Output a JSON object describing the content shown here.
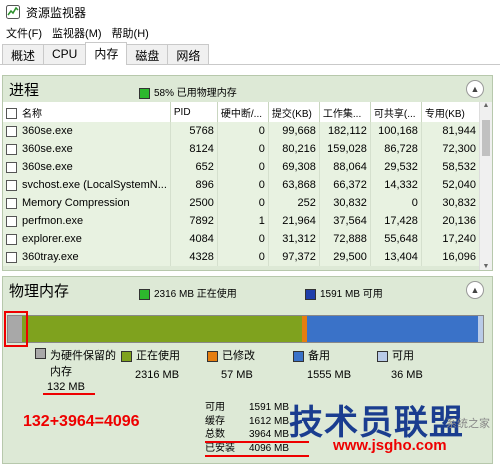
{
  "window": {
    "title": "资源监视器"
  },
  "menu": [
    "文件(F)",
    "监视器(M)",
    "帮助(H)"
  ],
  "tabs": [
    "概述",
    "CPU",
    "内存",
    "磁盘",
    "网络"
  ],
  "process": {
    "title": "进程",
    "usage": "58% 已用物理内存",
    "columns": [
      "名称",
      "PID",
      "硬中断/...",
      "提交(KB)",
      "工作集...",
      "可共享(...",
      "专用(KB)"
    ],
    "rows": [
      [
        "360se.exe",
        "5768",
        "0",
        "99,668",
        "182,112",
        "100,168",
        "81,944"
      ],
      [
        "360se.exe",
        "8124",
        "0",
        "80,216",
        "159,028",
        "86,728",
        "72,300"
      ],
      [
        "360se.exe",
        "652",
        "0",
        "69,308",
        "88,064",
        "29,532",
        "58,532"
      ],
      [
        "svchost.exe (LocalSystemN...",
        "896",
        "0",
        "63,868",
        "66,372",
        "14,332",
        "52,040"
      ],
      [
        "Memory Compression",
        "2500",
        "0",
        "252",
        "30,832",
        "0",
        "30,832"
      ],
      [
        "perfmon.exe",
        "7892",
        "1",
        "21,964",
        "37,564",
        "17,428",
        "20,136"
      ],
      [
        "explorer.exe",
        "4084",
        "0",
        "31,312",
        "72,888",
        "55,648",
        "17,240"
      ],
      [
        "360tray.exe",
        "4328",
        "0",
        "97,372",
        "29,500",
        "13,404",
        "16,096"
      ]
    ]
  },
  "physical": {
    "title": "物理内存",
    "in_use": "2316 MB 正在使用",
    "available": "1591 MB 可用",
    "bar_mb": {
      "reserved": 132,
      "in_use": 2316,
      "modified": 57,
      "standby": 1555,
      "free": 36
    },
    "legend": [
      {
        "label": "为硬件保留的\n内存",
        "value": "132 MB",
        "color": "#a8a8a8"
      },
      {
        "label": "正在使用",
        "value": "2316 MB",
        "color": "#7fa21e"
      },
      {
        "label": "已修改",
        "value": "57 MB",
        "color": "#e57e10"
      },
      {
        "label": "备用",
        "value": "1555 MB",
        "color": "#3a72c8"
      },
      {
        "label": "可用",
        "value": "36 MB",
        "color": "#b9cbe8"
      }
    ],
    "stats": [
      {
        "k": "可用",
        "v": "1591 MB"
      },
      {
        "k": "缓存",
        "v": "1612 MB"
      },
      {
        "k": "总数",
        "v": "3964 MB"
      },
      {
        "k": "已安装",
        "v": "4096 MB"
      }
    ]
  },
  "annotation": {
    "equation": "132+3964=4096"
  },
  "watermark": {
    "text": "技术员联盟",
    "url": "www.jsgho.com",
    "corner": "系统之家"
  }
}
